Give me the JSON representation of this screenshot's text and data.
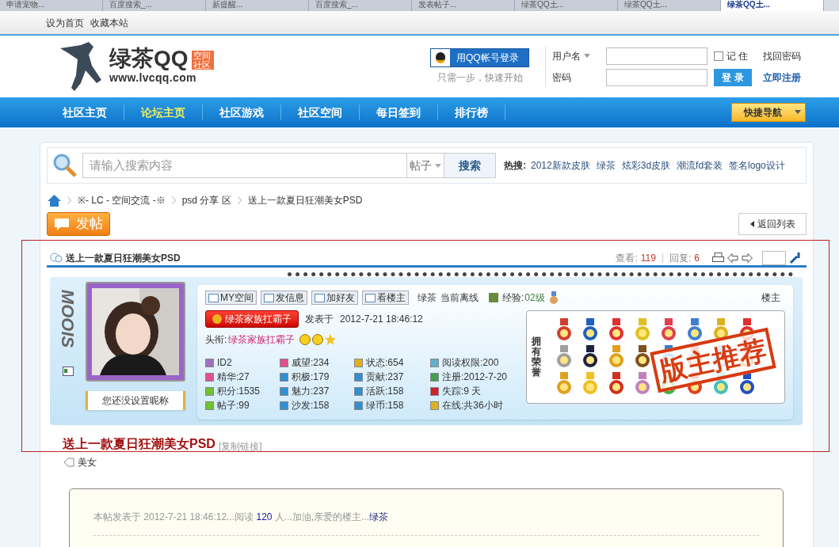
{
  "browser_tabs": [
    {
      "label": "申请宠物...",
      "selected": false
    },
    {
      "label": "百度搜索_...",
      "selected": false
    },
    {
      "label": "新提醒...",
      "selected": false
    },
    {
      "label": "百度搜索_...",
      "selected": false
    },
    {
      "label": "发表帖子...",
      "selected": false
    },
    {
      "label": "绿茶QQ土...",
      "selected": false
    },
    {
      "label": "绿茶QQ土...",
      "selected": false
    },
    {
      "label": "绿茶QQ土...",
      "selected": true
    }
  ],
  "top_links": [
    "设为首页",
    "收藏本站"
  ],
  "logo": {
    "name": "绿茶QQ",
    "tag": "空间社区",
    "url": "www.lvcqq.com"
  },
  "login": {
    "qq_button": "用QQ帐号登录",
    "qq_hint": "只需一步，快速开始",
    "username_label": "用户名",
    "password_label": "密码",
    "remember_label": "记 住",
    "remember": false,
    "find_password": "找回密码",
    "submit": "登 录",
    "register": "立即注册"
  },
  "nav": [
    {
      "label": "社区主页",
      "selected": false
    },
    {
      "label": "论坛主页",
      "selected": true
    },
    {
      "label": "社区游戏",
      "selected": false
    },
    {
      "label": "社区空间",
      "selected": false
    },
    {
      "label": "每日签到",
      "selected": false
    },
    {
      "label": "排行榜",
      "selected": false
    }
  ],
  "quick_nav": "快捷导航",
  "search": {
    "placeholder": "请输入搜索内容",
    "scope": "帖子",
    "button": "搜索",
    "hot_label": "热搜:",
    "hot": [
      "2012新款皮肤",
      "绿茶",
      "炫彩3d皮肤",
      "潮流fd套装",
      "签名logo设计"
    ]
  },
  "breadcrumb": [
    "※- LC - 空间交流 -※",
    "psd 分享 区",
    "送上一款夏日狂潮美女PSD"
  ],
  "post_button": "发帖",
  "back_button": "返回列表",
  "thread": {
    "title": "送上一款夏日狂潮美女PSD",
    "views_label": "查看:",
    "views": "119",
    "replies_label": "回复:",
    "replies": "6"
  },
  "profile": {
    "side_logo": "MOOIS",
    "nickname_button": "您还没设置昵称",
    "actions": [
      "MY空间",
      "发信息",
      "加好友",
      "看楼主"
    ],
    "user": "绿茶",
    "status": "当前离线",
    "exp_label": "经验:",
    "exp": "02级",
    "floor": "楼主",
    "badge": "绿茶家族扛霸子",
    "posted_label": "发表于",
    "posted": "2012-7-21 18:46:12",
    "title_label": "头衔:",
    "title": "绿茶家族扛霸子",
    "stats": [
      {
        "text": "ID2",
        "color": "#a070c0"
      },
      {
        "text": "威望:234",
        "color": "#e05090"
      },
      {
        "text": "状态:654",
        "color": "#e0b020"
      },
      {
        "text": "阅读权限:200",
        "color": "#60b0d0"
      },
      {
        "text": "精华:27",
        "color": "#e05090"
      },
      {
        "text": "积极:179",
        "color": "#3090d0"
      },
      {
        "text": "贡献:237",
        "color": "#3090d0"
      },
      {
        "text": "注册:2012-7-20",
        "color": "#40a050"
      },
      {
        "text": "积分:1535",
        "color": "#70c030"
      },
      {
        "text": "魅力:237",
        "color": "#3090d0"
      },
      {
        "text": "活跃:158",
        "color": "#3090d0"
      },
      {
        "text": "失踪:9 天",
        "color": "#d02030"
      },
      {
        "text": "帖子:99",
        "color": "#70c030"
      },
      {
        "text": "沙发:158",
        "color": "#3090d0"
      },
      {
        "text": "绿币:158",
        "color": "#3090d0"
      },
      {
        "text": "在线:共36小时",
        "color": "#e0b020"
      }
    ],
    "honor_label": "拥有荣誉",
    "stamp": "版主推荐"
  },
  "post_title": "送上一款夏日狂潮美女PSD",
  "copy_link": "[复制链接]",
  "tag": "美女",
  "notice": {
    "prefix": "本帖发表于",
    "time": "2012-7-21 18:46:12...阅读",
    "count": "120",
    "middle": "人...加油,亲爱的楼主...",
    "user": "绿茶"
  }
}
